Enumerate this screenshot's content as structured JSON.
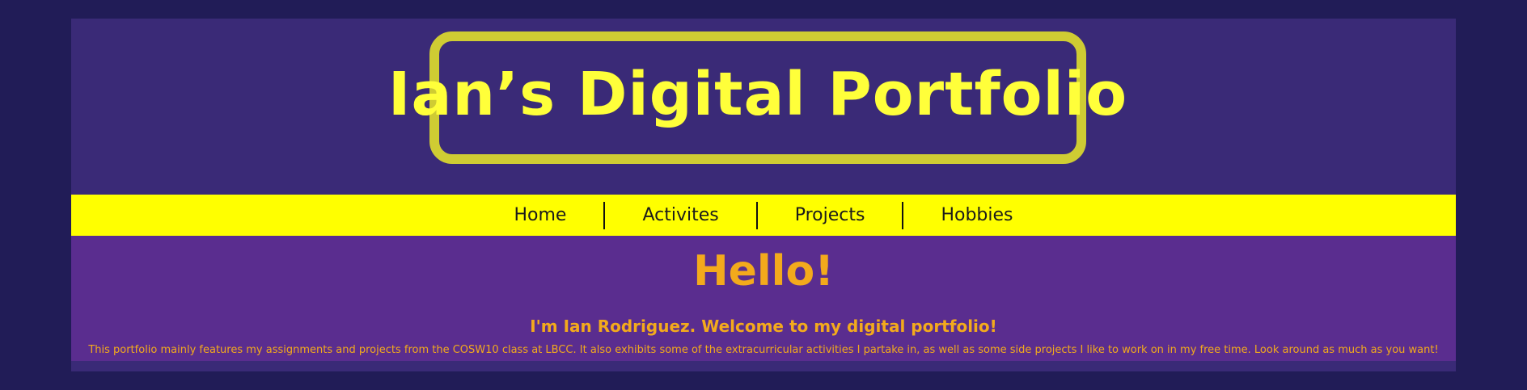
{
  "header": {
    "logo_text": "Ian’s Digital Portfolio"
  },
  "nav": {
    "items": [
      {
        "label": "Home"
      },
      {
        "label": "Activites"
      },
      {
        "label": "Projects"
      },
      {
        "label": "Hobbies"
      }
    ]
  },
  "main": {
    "heading": "Hello!",
    "subheading": "I'm Ian Rodriguez. Welcome to my digital portfolio!",
    "description": "This portfolio mainly features my assignments and projects from the COSW10 class at LBCC. It also exhibits some of the extracurricular activities I partake in, as well as some side projects I like to work on in my free time. Look around as much as you want!"
  },
  "colors": {
    "background": "#211c57",
    "header_bg": "#3a2a77",
    "logo_border": "#cfcc33",
    "logo_text": "#ffff3a",
    "nav_bg": "#ffff00",
    "content_bg": "#5a2d8f",
    "accent_text": "#f3aa1c"
  }
}
